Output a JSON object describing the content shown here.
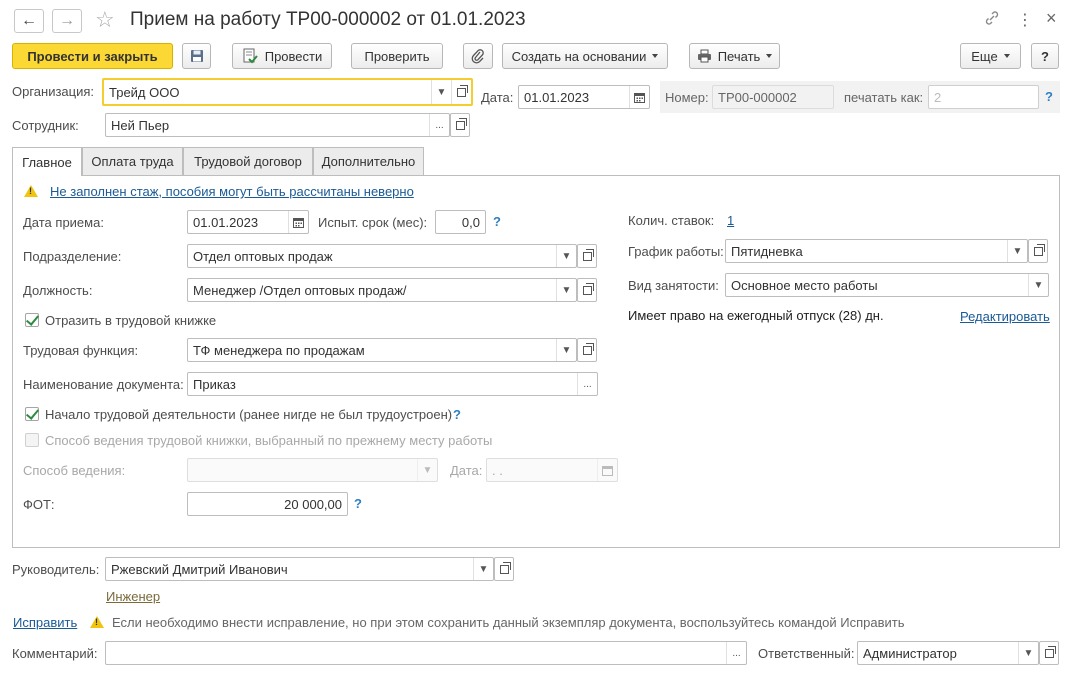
{
  "window": {
    "title": "Прием на работу ТР00-000002 от 01.01.2023",
    "back_icon": "←",
    "forward_icon": "→",
    "star_icon": "☆",
    "link_icon": "🔗",
    "more_icon": "⋮",
    "close_icon": "×"
  },
  "toolbar": {
    "post_and_close": "Провести и закрыть",
    "post": "Провести",
    "check": "Проверить",
    "create_based_on": "Создать на основании",
    "print": "Печать",
    "more": "Еще",
    "help": "?"
  },
  "header": {
    "org_label": "Организация:",
    "org_value": "Трейд ООО",
    "date_label": "Дата:",
    "date_value": "01.01.2023",
    "number_label": "Номер:",
    "number_value": "ТР00-000002",
    "print_as_label": "печатать как:",
    "print_as_placeholder": "2",
    "employee_label": "Сотрудник:",
    "employee_value": "Ней Пьер"
  },
  "tabs": [
    "Главное",
    "Оплата труда",
    "Трудовой договор",
    "Дополнительно"
  ],
  "main": {
    "warning_link": "Не заполнен стаж, пособия могут быть рассчитаны неверно",
    "hire_date_label": "Дата приема:",
    "hire_date_value": "01.01.2023",
    "probation_label": "Испыт. срок (мес):",
    "probation_value": "0,0",
    "department_label": "Подразделение:",
    "department_value": "Отдел оптовых продаж",
    "position_label": "Должность:",
    "position_value": "Менеджер /Отдел оптовых продаж/",
    "reflect_workbook_label": "Отразить в трудовой книжке",
    "labor_function_label": "Трудовая функция:",
    "labor_function_value": "ТФ менеджера по продажам",
    "doc_name_label": "Наименование документа:",
    "doc_name_value": "Приказ",
    "career_start_label": "Начало трудовой деятельности (ранее нигде не был трудоустроен)",
    "workbook_method_label": "Способ ведения трудовой книжки, выбранный по прежнему месту работы",
    "method_label": "Способ ведения:",
    "method_date_label": "Дата:",
    "method_date_value": " .  .",
    "fot_label": "ФОТ:",
    "fot_value": "20 000,00",
    "rates_label": "Колич. ставок:",
    "rates_value": "1",
    "schedule_label": "График работы:",
    "schedule_value": "Пятидневка",
    "employment_type_label": "Вид занятости:",
    "employment_type_value": "Основное место работы",
    "vacation_text": "Имеет право на ежегодный отпуск (28) дн.",
    "edit_link": "Редактировать"
  },
  "footer": {
    "manager_label": "Руководитель:",
    "manager_value": "Ржевский Дмитрий Иванович",
    "manager_position": "Инженер",
    "correct_link": "Исправить",
    "correct_hint": "Если необходимо внести исправление, но при этом сохранить данный экземпляр документа, воспользуйтесь командой Исправить",
    "comment_label": "Комментарий:",
    "responsible_label": "Ответственный:",
    "responsible_value": "Администратор"
  },
  "colors": {
    "accent_yellow": "#fbd834",
    "link_blue": "#1a5a96",
    "help_blue": "#2f7fc1",
    "check_green": "#2d8a3e",
    "warning_yellow": "#f1c40f"
  }
}
